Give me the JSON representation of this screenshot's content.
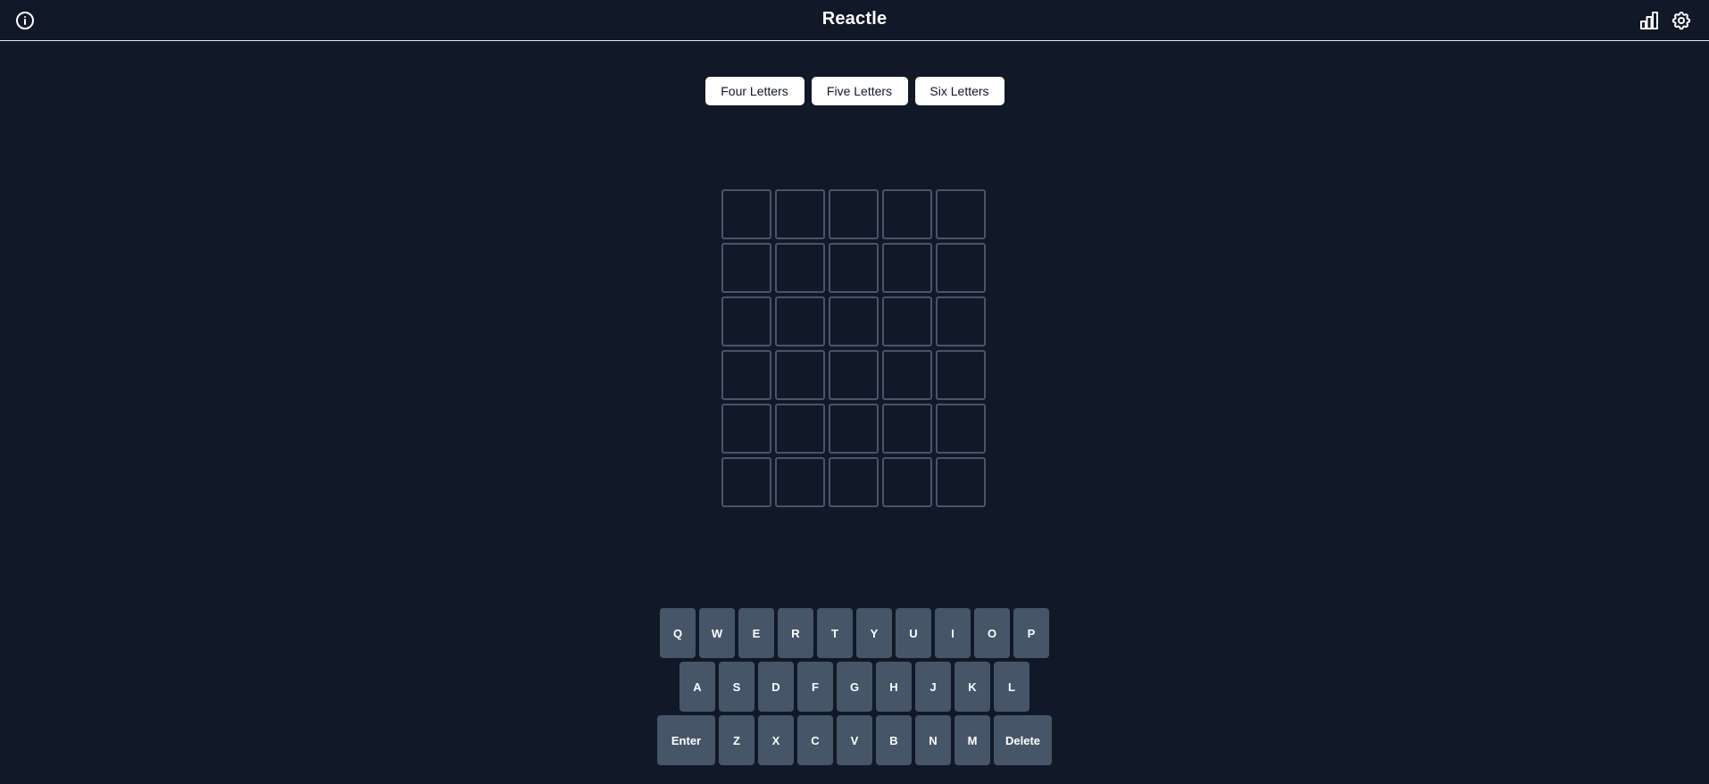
{
  "app": {
    "title": "Reactle"
  },
  "header": {
    "info_icon": "info-circle-icon",
    "stats_icon": "bar-chart-icon",
    "settings_icon": "gear-icon"
  },
  "length_options": [
    "Four Letters",
    "Five Letters",
    "Six Letters"
  ],
  "board": {
    "rows": [
      [
        "",
        "",
        "",
        "",
        ""
      ],
      [
        "",
        "",
        "",
        "",
        ""
      ],
      [
        "",
        "",
        "",
        "",
        ""
      ],
      [
        "",
        "",
        "",
        "",
        ""
      ],
      [
        "",
        "",
        "",
        "",
        ""
      ],
      [
        "",
        "",
        "",
        "",
        ""
      ]
    ]
  },
  "keyboard": {
    "row1": [
      "Q",
      "W",
      "E",
      "R",
      "T",
      "Y",
      "U",
      "I",
      "O",
      "P"
    ],
    "row2": [
      "A",
      "S",
      "D",
      "F",
      "G",
      "H",
      "J",
      "K",
      "L"
    ],
    "row3": [
      "Enter",
      "Z",
      "X",
      "C",
      "V",
      "B",
      "N",
      "M",
      "Delete"
    ]
  },
  "colors": {
    "background": "#111827",
    "cell_border": "#475569",
    "key_bg": "#475569",
    "button_bg": "#ffffff"
  }
}
